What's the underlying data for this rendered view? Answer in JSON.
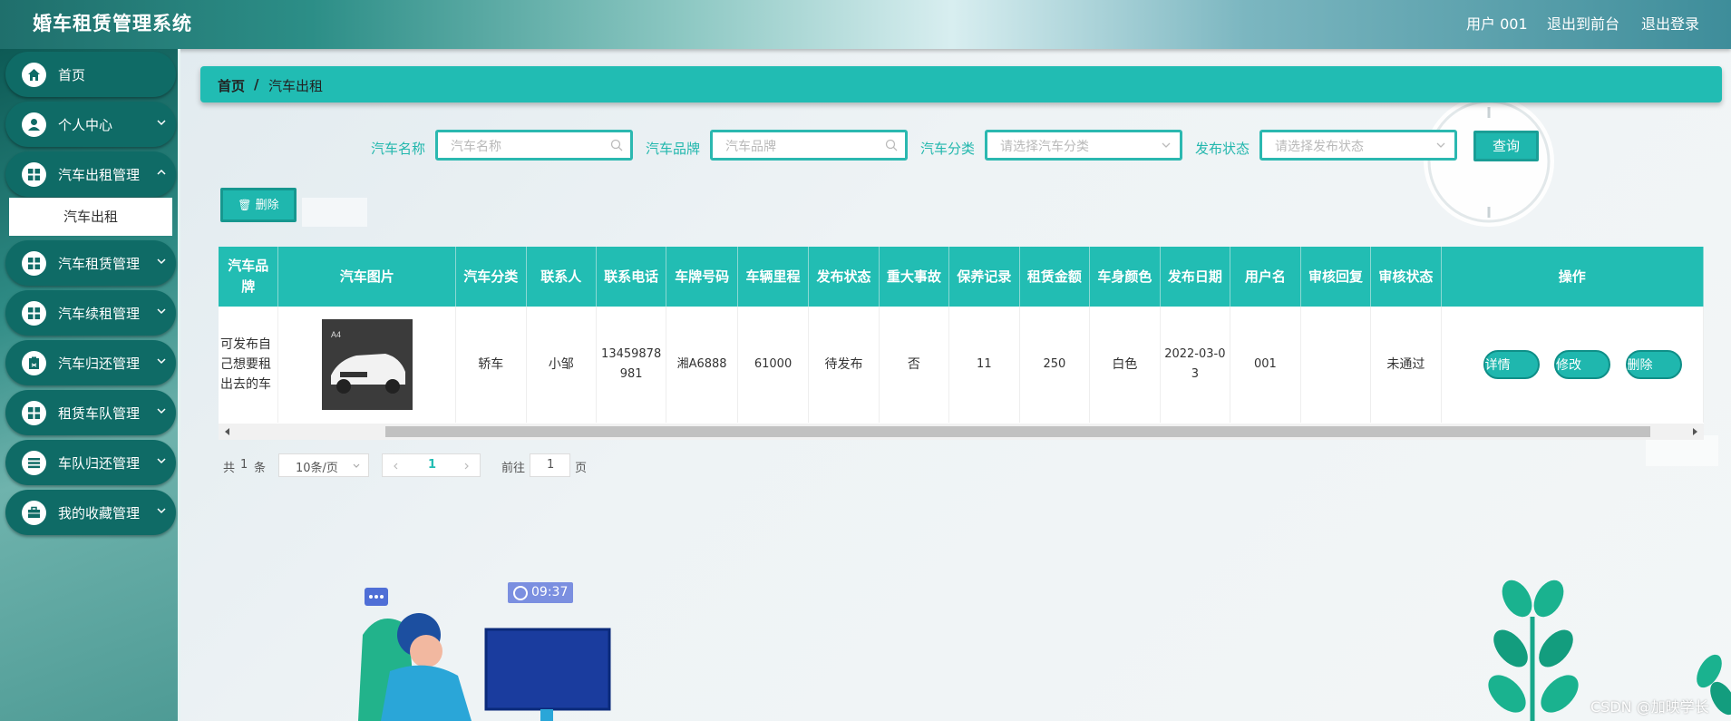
{
  "header": {
    "app_title": "婚车租赁管理系统",
    "user_label": "用户 001",
    "to_front": "退出到前台",
    "logout": "退出登录"
  },
  "sidebar": {
    "items": [
      {
        "label": "首页",
        "icon": "home-icon"
      },
      {
        "label": "个人中心",
        "icon": "user-icon"
      },
      {
        "label": "汽车出租管理",
        "icon": "grid-icon"
      },
      {
        "label": "汽车租赁管理",
        "icon": "grid-icon"
      },
      {
        "label": "汽车续租管理",
        "icon": "grid-icon"
      },
      {
        "label": "汽车归还管理",
        "icon": "clipboard-icon"
      },
      {
        "label": "租赁车队管理",
        "icon": "grid-icon"
      },
      {
        "label": "车队归还管理",
        "icon": "list-icon"
      },
      {
        "label": "我的收藏管理",
        "icon": "briefcase-icon"
      }
    ],
    "active_sub": "汽车出租"
  },
  "breadcrumb": {
    "home": "首页",
    "sep": "/",
    "current": "汽车出租"
  },
  "search": {
    "name_label": "汽车名称",
    "name_placeholder": "汽车名称",
    "brand_label": "汽车品牌",
    "brand_placeholder": "汽车品牌",
    "category_label": "汽车分类",
    "category_placeholder": "请选择汽车分类",
    "status_label": "发布状态",
    "status_placeholder": "请选择发布状态",
    "query_button": "查询"
  },
  "toolbar": {
    "delete_label": "删除"
  },
  "table": {
    "headers": [
      "汽车品牌",
      "汽车图片",
      "汽车分类",
      "联系人",
      "联系电话",
      "车牌号码",
      "车辆里程",
      "发布状态",
      "重大事故",
      "保养记录",
      "租赁金额",
      "车身颜色",
      "发布日期",
      "用户名",
      "审核回复",
      "审核状态",
      "操作"
    ],
    "rows": [
      {
        "brand": "可发布自己想要租出去的车",
        "category": "轿车",
        "contact": "小邹",
        "phone": "13459878981",
        "plate": "湘A6888",
        "mileage": "61000",
        "publish_status": "待发布",
        "accident": "否",
        "maintenance": "11",
        "rent": "250",
        "color": "白色",
        "date": "2022-03-03",
        "username": "001",
        "review_reply": "",
        "review_status": "未通过",
        "actions": [
          "详情",
          "修改",
          "删除"
        ]
      }
    ]
  },
  "pagination": {
    "total_prefix": "共",
    "total": "1",
    "total_suffix": "条",
    "page_size": "10条/页",
    "current_page": "1",
    "goto_prefix": "前往",
    "goto_value": "1",
    "goto_suffix": "页"
  },
  "illustration": {
    "clock_badge": "09:37"
  },
  "watermark": "CSDN @加映学长",
  "colors": {
    "accent": "#22bdb3",
    "sidebar": "#0f6b66"
  }
}
